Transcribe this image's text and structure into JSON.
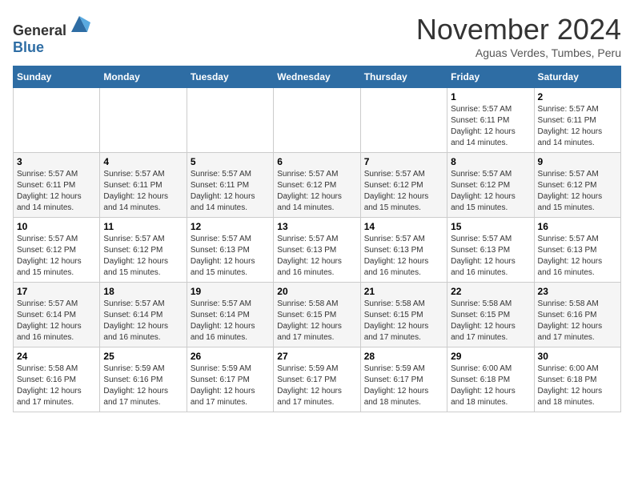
{
  "header": {
    "logo_general": "General",
    "logo_blue": "Blue",
    "month_title": "November 2024",
    "location": "Aguas Verdes, Tumbes, Peru"
  },
  "weekdays": [
    "Sunday",
    "Monday",
    "Tuesday",
    "Wednesday",
    "Thursday",
    "Friday",
    "Saturday"
  ],
  "weeks": [
    [
      {
        "day": "",
        "sunrise": "",
        "sunset": "",
        "daylight": ""
      },
      {
        "day": "",
        "sunrise": "",
        "sunset": "",
        "daylight": ""
      },
      {
        "day": "",
        "sunrise": "",
        "sunset": "",
        "daylight": ""
      },
      {
        "day": "",
        "sunrise": "",
        "sunset": "",
        "daylight": ""
      },
      {
        "day": "",
        "sunrise": "",
        "sunset": "",
        "daylight": ""
      },
      {
        "day": "1",
        "sunrise": "Sunrise: 5:57 AM",
        "sunset": "Sunset: 6:11 PM",
        "daylight": "Daylight: 12 hours and 14 minutes."
      },
      {
        "day": "2",
        "sunrise": "Sunrise: 5:57 AM",
        "sunset": "Sunset: 6:11 PM",
        "daylight": "Daylight: 12 hours and 14 minutes."
      }
    ],
    [
      {
        "day": "3",
        "sunrise": "Sunrise: 5:57 AM",
        "sunset": "Sunset: 6:11 PM",
        "daylight": "Daylight: 12 hours and 14 minutes."
      },
      {
        "day": "4",
        "sunrise": "Sunrise: 5:57 AM",
        "sunset": "Sunset: 6:11 PM",
        "daylight": "Daylight: 12 hours and 14 minutes."
      },
      {
        "day": "5",
        "sunrise": "Sunrise: 5:57 AM",
        "sunset": "Sunset: 6:11 PM",
        "daylight": "Daylight: 12 hours and 14 minutes."
      },
      {
        "day": "6",
        "sunrise": "Sunrise: 5:57 AM",
        "sunset": "Sunset: 6:12 PM",
        "daylight": "Daylight: 12 hours and 14 minutes."
      },
      {
        "day": "7",
        "sunrise": "Sunrise: 5:57 AM",
        "sunset": "Sunset: 6:12 PM",
        "daylight": "Daylight: 12 hours and 15 minutes."
      },
      {
        "day": "8",
        "sunrise": "Sunrise: 5:57 AM",
        "sunset": "Sunset: 6:12 PM",
        "daylight": "Daylight: 12 hours and 15 minutes."
      },
      {
        "day": "9",
        "sunrise": "Sunrise: 5:57 AM",
        "sunset": "Sunset: 6:12 PM",
        "daylight": "Daylight: 12 hours and 15 minutes."
      }
    ],
    [
      {
        "day": "10",
        "sunrise": "Sunrise: 5:57 AM",
        "sunset": "Sunset: 6:12 PM",
        "daylight": "Daylight: 12 hours and 15 minutes."
      },
      {
        "day": "11",
        "sunrise": "Sunrise: 5:57 AM",
        "sunset": "Sunset: 6:12 PM",
        "daylight": "Daylight: 12 hours and 15 minutes."
      },
      {
        "day": "12",
        "sunrise": "Sunrise: 5:57 AM",
        "sunset": "Sunset: 6:13 PM",
        "daylight": "Daylight: 12 hours and 15 minutes."
      },
      {
        "day": "13",
        "sunrise": "Sunrise: 5:57 AM",
        "sunset": "Sunset: 6:13 PM",
        "daylight": "Daylight: 12 hours and 16 minutes."
      },
      {
        "day": "14",
        "sunrise": "Sunrise: 5:57 AM",
        "sunset": "Sunset: 6:13 PM",
        "daylight": "Daylight: 12 hours and 16 minutes."
      },
      {
        "day": "15",
        "sunrise": "Sunrise: 5:57 AM",
        "sunset": "Sunset: 6:13 PM",
        "daylight": "Daylight: 12 hours and 16 minutes."
      },
      {
        "day": "16",
        "sunrise": "Sunrise: 5:57 AM",
        "sunset": "Sunset: 6:13 PM",
        "daylight": "Daylight: 12 hours and 16 minutes."
      }
    ],
    [
      {
        "day": "17",
        "sunrise": "Sunrise: 5:57 AM",
        "sunset": "Sunset: 6:14 PM",
        "daylight": "Daylight: 12 hours and 16 minutes."
      },
      {
        "day": "18",
        "sunrise": "Sunrise: 5:57 AM",
        "sunset": "Sunset: 6:14 PM",
        "daylight": "Daylight: 12 hours and 16 minutes."
      },
      {
        "day": "19",
        "sunrise": "Sunrise: 5:57 AM",
        "sunset": "Sunset: 6:14 PM",
        "daylight": "Daylight: 12 hours and 16 minutes."
      },
      {
        "day": "20",
        "sunrise": "Sunrise: 5:58 AM",
        "sunset": "Sunset: 6:15 PM",
        "daylight": "Daylight: 12 hours and 17 minutes."
      },
      {
        "day": "21",
        "sunrise": "Sunrise: 5:58 AM",
        "sunset": "Sunset: 6:15 PM",
        "daylight": "Daylight: 12 hours and 17 minutes."
      },
      {
        "day": "22",
        "sunrise": "Sunrise: 5:58 AM",
        "sunset": "Sunset: 6:15 PM",
        "daylight": "Daylight: 12 hours and 17 minutes."
      },
      {
        "day": "23",
        "sunrise": "Sunrise: 5:58 AM",
        "sunset": "Sunset: 6:16 PM",
        "daylight": "Daylight: 12 hours and 17 minutes."
      }
    ],
    [
      {
        "day": "24",
        "sunrise": "Sunrise: 5:58 AM",
        "sunset": "Sunset: 6:16 PM",
        "daylight": "Daylight: 12 hours and 17 minutes."
      },
      {
        "day": "25",
        "sunrise": "Sunrise: 5:59 AM",
        "sunset": "Sunset: 6:16 PM",
        "daylight": "Daylight: 12 hours and 17 minutes."
      },
      {
        "day": "26",
        "sunrise": "Sunrise: 5:59 AM",
        "sunset": "Sunset: 6:17 PM",
        "daylight": "Daylight: 12 hours and 17 minutes."
      },
      {
        "day": "27",
        "sunrise": "Sunrise: 5:59 AM",
        "sunset": "Sunset: 6:17 PM",
        "daylight": "Daylight: 12 hours and 17 minutes."
      },
      {
        "day": "28",
        "sunrise": "Sunrise: 5:59 AM",
        "sunset": "Sunset: 6:17 PM",
        "daylight": "Daylight: 12 hours and 18 minutes."
      },
      {
        "day": "29",
        "sunrise": "Sunrise: 6:00 AM",
        "sunset": "Sunset: 6:18 PM",
        "daylight": "Daylight: 12 hours and 18 minutes."
      },
      {
        "day": "30",
        "sunrise": "Sunrise: 6:00 AM",
        "sunset": "Sunset: 6:18 PM",
        "daylight": "Daylight: 12 hours and 18 minutes."
      }
    ]
  ]
}
